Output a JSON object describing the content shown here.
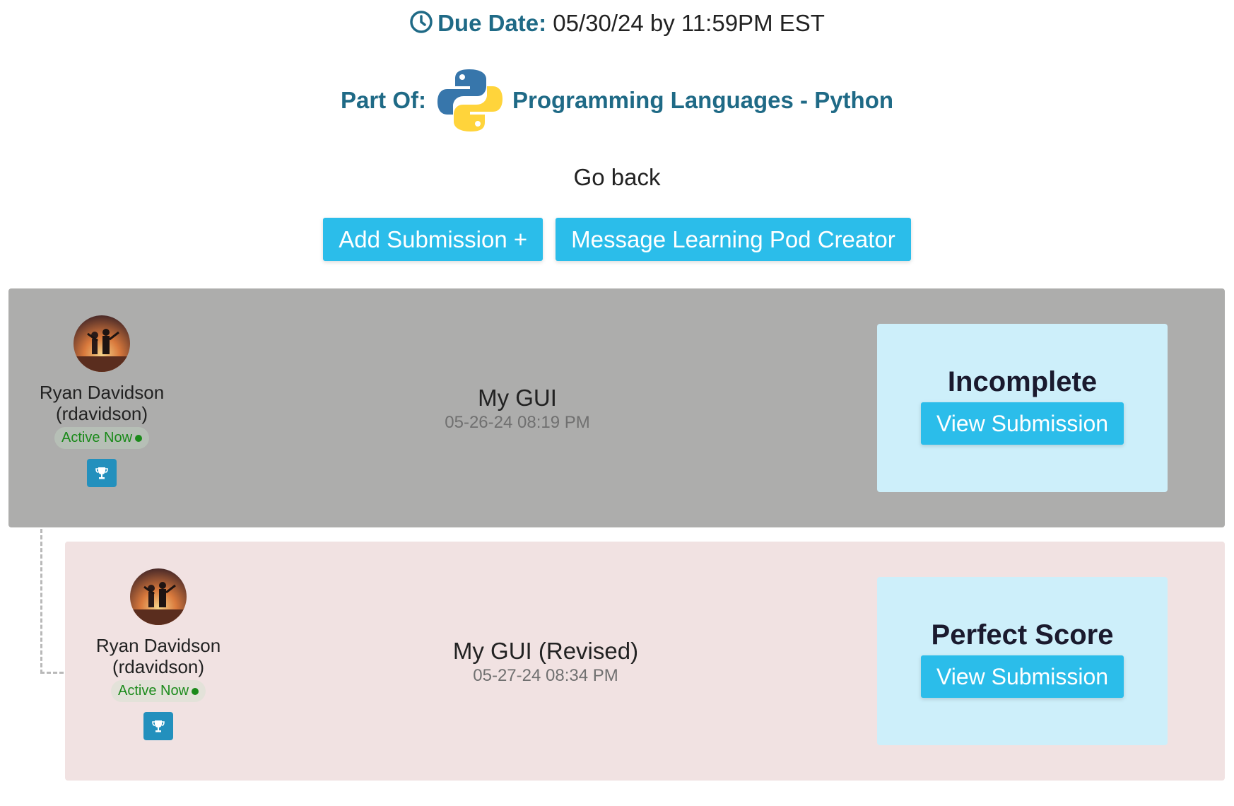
{
  "due": {
    "label": "Due Date:",
    "value": "05/30/24 by 11:59PM EST",
    "icon": "clock-icon"
  },
  "part_of": {
    "label": "Part Of:",
    "course": "Programming Languages - Python",
    "icon": "python-logo"
  },
  "go_back": "Go back",
  "actions": {
    "add_submission": "Add Submission +",
    "message_creator": "Message Learning Pod Creator"
  },
  "submissions": [
    {
      "user_name": "Ryan Davidson",
      "user_handle": "(rdavidson)",
      "status_badge": "Active Now",
      "title": "My GUI",
      "timestamp": "05-26-24 08:19 PM",
      "status": "Incomplete",
      "view_label": "View Submission",
      "card_color": "#adadac"
    },
    {
      "user_name": "Ryan Davidson",
      "user_handle": "(rdavidson)",
      "status_badge": "Active Now",
      "title": "My GUI (Revised)",
      "timestamp": "05-27-24 08:34 PM",
      "status": "Perfect Score",
      "view_label": "View Submission",
      "card_color": "#f1e2e2"
    }
  ],
  "colors": {
    "accent": "#1f6a86",
    "button": "#2bbdea",
    "status_box": "#cdeffa",
    "active_green": "#1a8a1a"
  }
}
